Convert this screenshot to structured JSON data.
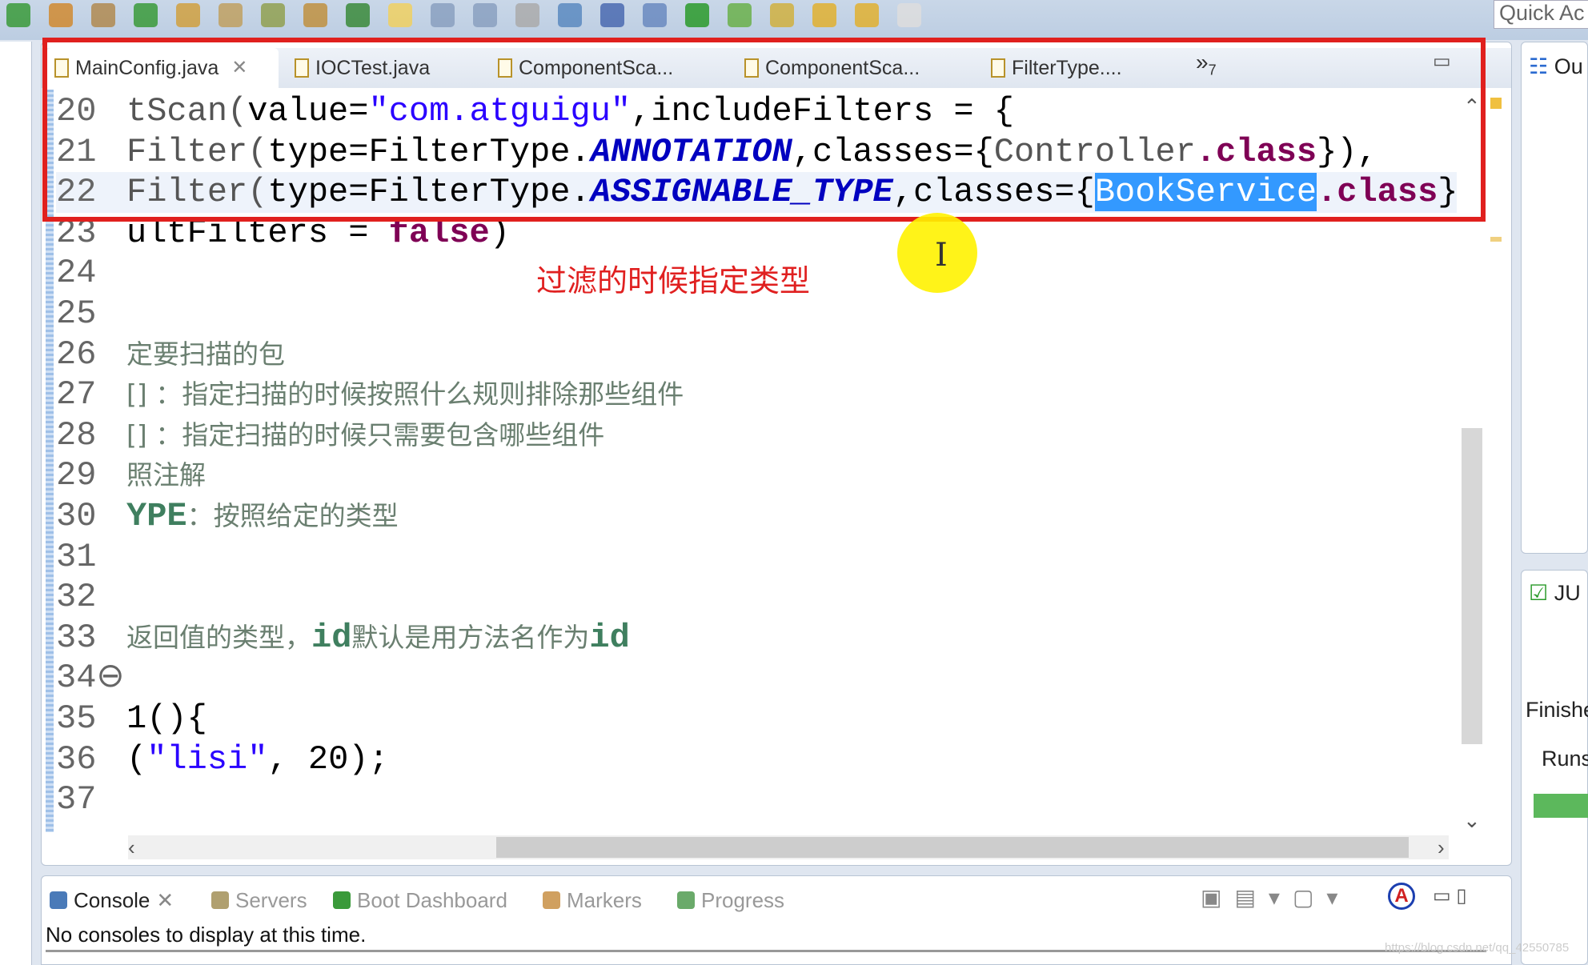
{
  "toolbar": {
    "quick_access": "Quick Ac",
    "icons": [
      "run-icon",
      "new-icon",
      "package-icon",
      "refresh-icon",
      "open-icon",
      "build-icon",
      "folder-icon",
      "folder-open-icon",
      "pin-icon",
      "highlight-icon",
      "document-icon",
      "paragraph-icon",
      "link-icon",
      "globe-icon",
      "monitor-icon",
      "debug-icon",
      "spring-power-icon",
      "spring-leaf-icon",
      "next-annotation-icon",
      "prev-annotation-icon",
      "back-icon",
      "forward-icon"
    ]
  },
  "editor": {
    "tabs": [
      {
        "label": "MainConfig.java",
        "active": true
      },
      {
        "label": "IOCTest.java"
      },
      {
        "label": "ComponentSca..."
      },
      {
        "label": "ComponentSca..."
      },
      {
        "label": "FilterType...."
      }
    ],
    "overflow": "»",
    "overflow_count": "7",
    "lines": [
      {
        "n": "20",
        "segs": [
          [
            "gr",
            "tScan("
          ],
          [
            "",
            "value="
          ],
          [
            "str",
            "\"com.atguigu\""
          ],
          [
            "",
            ",includeFilters = {"
          ]
        ]
      },
      {
        "n": "21",
        "segs": [
          [
            "gr",
            "Filter("
          ],
          [
            "",
            "type=FilterType."
          ],
          [
            "cst",
            "ANNOTATION"
          ],
          [
            "",
            ",classes={"
          ],
          [
            "gr",
            "Controller"
          ],
          [
            "kw",
            ".class"
          ],
          [
            "",
            "}),"
          ]
        ]
      },
      {
        "n": "22",
        "cur": true,
        "segs": [
          [
            "gr",
            "Filter("
          ],
          [
            "",
            "type=FilterType."
          ],
          [
            "cst",
            "ASSIGNABLE_TYPE"
          ],
          [
            "",
            ",classes={"
          ],
          [
            "sel",
            "BookService"
          ],
          [
            "kw",
            ".class"
          ],
          [
            "",
            "}"
          ]
        ]
      },
      {
        "n": "23",
        "segs": [
          [
            "",
            "ultFilters = "
          ],
          [
            "kw",
            "false"
          ],
          [
            "",
            ")"
          ]
        ]
      },
      {
        "n": "24",
        "segs": []
      },
      {
        "n": "25",
        "segs": []
      },
      {
        "n": "26",
        "segs": [
          [
            "cm",
            "定要扫描的包"
          ]
        ]
      },
      {
        "n": "27",
        "segs": [
          [
            "cm",
            "[] ：指定扫描的时候按照什么规则排除那些组件"
          ]
        ]
      },
      {
        "n": "28",
        "segs": [
          [
            "cm",
            "[] ：指定扫描的时候只需要包含哪些组件"
          ]
        ]
      },
      {
        "n": "29",
        "segs": [
          [
            "cm",
            "照注解"
          ]
        ]
      },
      {
        "n": "30",
        "segs": [
          [
            "cmid",
            "YPE"
          ],
          [
            "cm",
            "：按照给定的类型"
          ]
        ]
      },
      {
        "n": "31",
        "segs": []
      },
      {
        "n": "32",
        "segs": []
      },
      {
        "n": "33",
        "segs": [
          [
            "cm",
            "返回值的类型，"
          ],
          [
            "cmid",
            "id"
          ],
          [
            "cm",
            "默认是用方法名作为"
          ],
          [
            "cmid",
            "id"
          ]
        ]
      },
      {
        "n": "34⊖",
        "segs": []
      },
      {
        "n": "35",
        "segs": [
          [
            "",
            "1(){"
          ]
        ]
      },
      {
        "n": "36",
        "segs": [
          [
            "",
            "("
          ],
          [
            "str",
            "\"lisi\""
          ],
          [
            "",
            ", 20);"
          ]
        ]
      },
      {
        "n": "37",
        "segs": []
      }
    ],
    "annotation": "过滤的时候指定类型"
  },
  "console": {
    "tabs": [
      {
        "label": "Console",
        "active": true,
        "color": "#4a7ab8"
      },
      {
        "label": "Servers",
        "color": "#b0a070"
      },
      {
        "label": "Boot Dashboard",
        "color": "#3a9a3a"
      },
      {
        "label": "Markers",
        "color": "#d0a060"
      },
      {
        "label": "Progress",
        "color": "#6aaa6a"
      }
    ],
    "message": "No consoles to display at this time."
  },
  "right": {
    "outline": "Ou",
    "junit": "JU",
    "finished": "Finishe",
    "runs": "Runs"
  },
  "colors": {
    "highlight_box": "#e0201e",
    "selection": "#3399ff",
    "junit_bar": "#5cb85c",
    "cursor_highlight": "#fff200"
  },
  "watermark": "https://blog.csdn.net/qq_42550785"
}
